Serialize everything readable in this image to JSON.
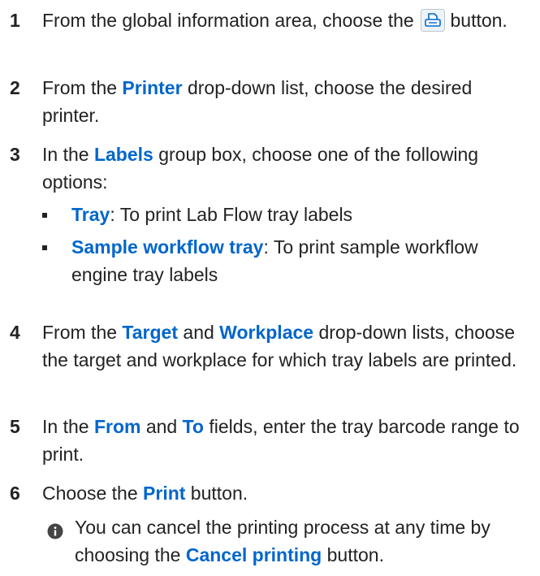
{
  "steps": [
    {
      "num": "1",
      "parts": [
        {
          "t": "From the global information area, choose the "
        },
        {
          "t": "",
          "icon": "printer-icon"
        },
        {
          "t": " button."
        }
      ]
    },
    {
      "num": "2",
      "parts": [
        {
          "t": "From the "
        },
        {
          "t": "Printer",
          "kw": true
        },
        {
          "t": " drop-down list, choose the desired printer."
        }
      ]
    },
    {
      "num": "3",
      "parts": [
        {
          "t": "In the "
        },
        {
          "t": "Labels",
          "kw": true
        },
        {
          "t": " group box, choose one of the following options:"
        }
      ]
    },
    {
      "num": "4",
      "parts": [
        {
          "t": "From the "
        },
        {
          "t": "Target",
          "kw": true
        },
        {
          "t": " and "
        },
        {
          "t": "Workplace",
          "kw": true
        },
        {
          "t": " drop-down lists, choose the target and workplace for which tray labels are printed."
        }
      ]
    },
    {
      "num": "5",
      "parts": [
        {
          "t": "In the "
        },
        {
          "t": "From",
          "kw": true
        },
        {
          "t": " and "
        },
        {
          "t": "To",
          "kw": true
        },
        {
          "t": " fields, enter the tray barcode range to print."
        }
      ]
    },
    {
      "num": "6",
      "parts": [
        {
          "t": "Choose the "
        },
        {
          "t": "Print",
          "kw": true
        },
        {
          "t": " button."
        }
      ]
    }
  ],
  "options": [
    {
      "label": "Tray",
      "desc": ": To print Lab Flow tray labels"
    },
    {
      "label": "Sample workflow tray",
      "desc": ": To print sample workflow engine tray labels"
    }
  ],
  "note": {
    "icon": "info-icon",
    "text_before": "You can cancel the printing process at any time by choosing the ",
    "kw": "Cancel printing",
    "text_after": " button."
  },
  "colors": {
    "accent": "#0066cc",
    "text": "#222222"
  }
}
